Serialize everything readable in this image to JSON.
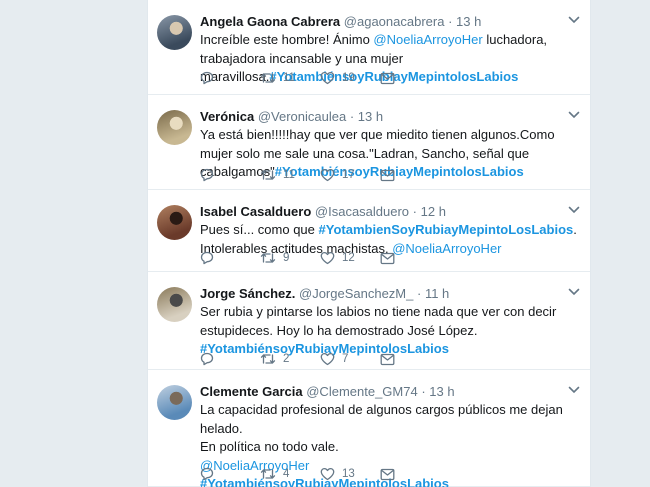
{
  "tweets": [
    {
      "name": "Angela Gaona Cabrera",
      "handle": "@agaonacabrera",
      "time": "13 h",
      "text_parts": [
        {
          "t": "Increíble este hombre! Ánimo ",
          "k": "plain"
        },
        {
          "t": "@NoeliaArroyoHer",
          "k": "mention"
        },
        {
          "t": " luchadora, trabajadora incansable y una mujer maravillosa.",
          "k": "plain"
        },
        {
          "t": "#YotambiénsoyRubiayMepintolosLabios",
          "k": "hashtag"
        }
      ],
      "reply_count": "",
      "retweet_count": "11",
      "like_count": "19",
      "avatar_colors": [
        "#3a4a5c",
        "#8a98a8",
        "#d8c8b0"
      ]
    },
    {
      "name": "Verónica",
      "handle": "@Veronicaulea",
      "time": "13 h",
      "text_parts": [
        {
          "t": "Ya está bien!!!!!hay que ver que miedito tienen algunos.Como mujer solo me sale una cosa.\"Ladran, Sancho, señal que cabalgamos\"",
          "k": "plain"
        },
        {
          "t": "#YotambiénsoyRubiayMepintolosLabios",
          "k": "hashtag"
        }
      ],
      "reply_count": "",
      "retweet_count": "11",
      "like_count": "17",
      "avatar_colors": [
        "#c8b892",
        "#7a6a4a",
        "#e8dcc0"
      ]
    },
    {
      "name": "Isabel Casalduero",
      "handle": "@Isacasalduero",
      "time": "12 h",
      "text_parts": [
        {
          "t": "Pues sí... como que ",
          "k": "plain"
        },
        {
          "t": "#YotambienSoyRubiayMepintoLosLabios",
          "k": "hashtag"
        },
        {
          "t": ". Intolerables actitudes machistas. ",
          "k": "plain"
        },
        {
          "t": "@NoeliaArroyoHer",
          "k": "mention"
        }
      ],
      "reply_count": "",
      "retweet_count": "9",
      "like_count": "12",
      "avatar_colors": [
        "#6a3a2a",
        "#b08060",
        "#2a1a14"
      ]
    },
    {
      "name": "Jorge Sánchez.",
      "handle": "@JorgeSanchezM_",
      "time": "11 h",
      "text_parts": [
        {
          "t": "Ser rubia y pintarse los labios no tiene nada que ver con decir estupideces. Hoy lo ha demostrado José López.",
          "k": "plain"
        },
        {
          "t": "\n",
          "k": "break"
        },
        {
          "t": "#YotambiénsoyRubiayMepintolosLabios",
          "k": "hashtag"
        }
      ],
      "reply_count": "",
      "retweet_count": "2",
      "like_count": "7",
      "avatar_colors": [
        "#d8d0c0",
        "#8a7a5a",
        "#4a4a4a"
      ]
    },
    {
      "name": "Clemente Garcia",
      "handle": "@Clemente_GM74",
      "time": "13 h",
      "text_parts": [
        {
          "t": "La capacidad profesional de algunos cargos públicos me dejan helado.",
          "k": "plain"
        },
        {
          "t": "\n",
          "k": "break"
        },
        {
          "t": "En política no todo vale.",
          "k": "plain"
        },
        {
          "t": "\n",
          "k": "break"
        },
        {
          "t": "@NoeliaArroyoHer",
          "k": "mention"
        },
        {
          "t": "\n",
          "k": "break"
        },
        {
          "t": "#YotambiénsoyRubiayMepintolosLabios",
          "k": "hashtag"
        }
      ],
      "reply_count": "",
      "retweet_count": "4",
      "like_count": "13",
      "avatar_colors": [
        "#5a8ab8",
        "#c0d0e0",
        "#7a6a5a"
      ]
    }
  ],
  "colors": {
    "link": "#1b95e0",
    "muted": "#657786",
    "text": "#14171a",
    "icon": "#657786"
  },
  "icons": [
    "reply-icon",
    "retweet-icon",
    "like-icon",
    "direct-message-icon",
    "chevron-down-icon"
  ]
}
